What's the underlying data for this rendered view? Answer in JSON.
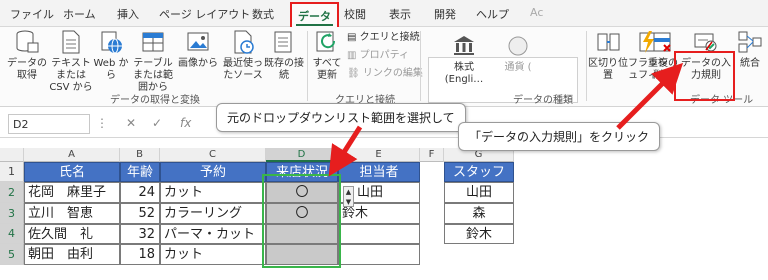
{
  "ribbon_tabs": [
    "ファイル",
    "ホーム",
    "挿入",
    "ページ レイアウト",
    "数式",
    "データ",
    "校閲",
    "表示",
    "開発",
    "ヘルプ",
    "Ac"
  ],
  "active_tab": "データ",
  "ribbon": {
    "get_data": "データの取得",
    "from_text_csv": "テキストまたは CSV から",
    "from_web": "Web から",
    "from_table": "テーブルまたは範囲から",
    "from_picture": "画像から",
    "recent_sources": "最近使ったソース",
    "existing_connections": "既存の接続",
    "group_get_transform": "データの取得と変換",
    "refresh_all": "すべて更新",
    "queries_connections": "クエリと接続",
    "properties": "プロパティ",
    "edit_links": "リンクの編集",
    "group_queries": "クエリと接続",
    "stocks": "株式 (Engli…",
    "currencies": "通貨 (",
    "group_datatypes": "データの種類",
    "text_to_columns": "区切り位置",
    "flash_fill": "フラッシュフィル",
    "remove_duplicates": "重複の削除",
    "data_validation": "データの入力規則",
    "consolidate": "統合",
    "group_data_tools": "データ ツール"
  },
  "formula_bar": {
    "name_box": "D2",
    "fx": "fx"
  },
  "columns": [
    "A",
    "B",
    "C",
    "D",
    "E",
    "F",
    "G"
  ],
  "rows": [
    "1",
    "2",
    "3",
    "4",
    "5"
  ],
  "table_headers": [
    "氏名",
    "年齢",
    "予約",
    "来店状況",
    "担当者"
  ],
  "table_rows": [
    {
      "name": "花岡　麻里子",
      "age": "24",
      "reservation": "カット",
      "status": "〇",
      "staff": "山田"
    },
    {
      "name": "立川　智恵",
      "age": "52",
      "reservation": "カラーリング",
      "status": "〇",
      "staff": "鈴木"
    },
    {
      "name": "佐久間　礼",
      "age": "32",
      "reservation": "パーマ・カット",
      "status": "",
      "staff": ""
    },
    {
      "name": "朝田　由利",
      "age": "18",
      "reservation": "カット",
      "status": "",
      "staff": ""
    }
  ],
  "staff_header": "スタッフ",
  "staff_list": [
    "山田",
    "森",
    "鈴木"
  ],
  "callout_range": "元のドロップダウンリスト範囲を選択して",
  "callout_validation": "「データの入力規則」をクリック",
  "colors": {
    "header_blue": "#4472c4",
    "excel_green": "#217346",
    "highlight_red": "#e61e1e",
    "selection_green": "#39b54a",
    "range_gray": "#c9c9c9"
  }
}
